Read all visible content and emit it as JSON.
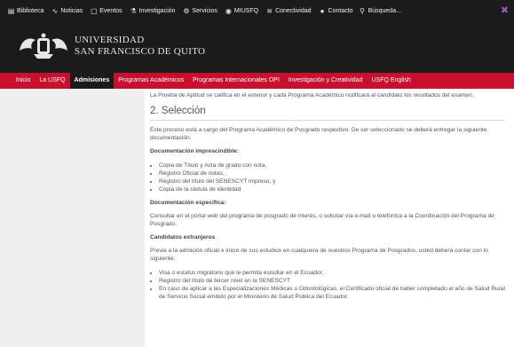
{
  "topbar": {
    "items": [
      {
        "icon": "book-icon",
        "label": "Biblioteca"
      },
      {
        "icon": "rss-icon",
        "label": "Noticias"
      },
      {
        "icon": "calendar-icon",
        "label": "Eventos"
      },
      {
        "icon": "flask-icon",
        "label": "Investigación"
      },
      {
        "icon": "gear-icon",
        "label": "Servicios"
      },
      {
        "icon": "user-circle-icon",
        "label": "MIUSFQ"
      },
      {
        "icon": "wifi-icon",
        "label": "Conectividad"
      },
      {
        "icon": "chat-icon",
        "label": "Contacto"
      }
    ],
    "search_label": "Búsqueda...",
    "accent": "#9b59b6"
  },
  "header": {
    "line1": "UNIVERSIDAD",
    "line2": "SAN FRANCISCO DE QUITO"
  },
  "nav": {
    "items": [
      "Inicio",
      "La USFQ",
      "Admisiones",
      "Programas Académicos",
      "Programas Internacionales OPI",
      "Investigación y Creatividad",
      "USFQ English"
    ],
    "active_index": 2,
    "color": "#c8102e"
  },
  "content": {
    "intro": "La Prueba de Aptitud se califica en el exterior y cada Programa Académico notificará al candidato los resultados del examen.",
    "section_title": "2. Selección",
    "section_intro": "Este proceso está a cargo del Programa Académico de Posgrado respectivo. De ser seleccionado se deberá entregar la siguiente documentación:",
    "doc_imprescindible_title": "Documentación imprescindible:",
    "doc_imprescindible_items": [
      "Copia de Título y Acta de grado con nota,",
      "Registro Oficial de notas,",
      "Registro del título del SENESCYT impreso, y",
      "Copia de la cédula de identidad"
    ],
    "doc_especifica_title": "Documentación específica:",
    "doc_especifica_text": "Consultar en el portal web del programa de posgrado de interés, o solicitar vía e-mail o telefónica a la Coordinación del Programa de Posgrado.",
    "extranjeros_title": "Candidatos extranjeros",
    "extranjeros_text": "Previa a la admisión oficial e inicio de sus estudios en cualquiera de nuestros Programa de Posgrados, usted deberá contar con lo siguiente:",
    "extranjeros_items": [
      "Visa o estatus migratorio que le permita estudiar en el Ecuador.",
      "Registro del título de tercer nivel en la SENESCYT",
      "En caso de aplicar a las Especializaciones Médicas u Odontológicas, el Certificado oficial de haber completado el año de Salud Rural de Servicio Social emitido por el Ministerio de Salud Pública del Ecuador."
    ]
  }
}
